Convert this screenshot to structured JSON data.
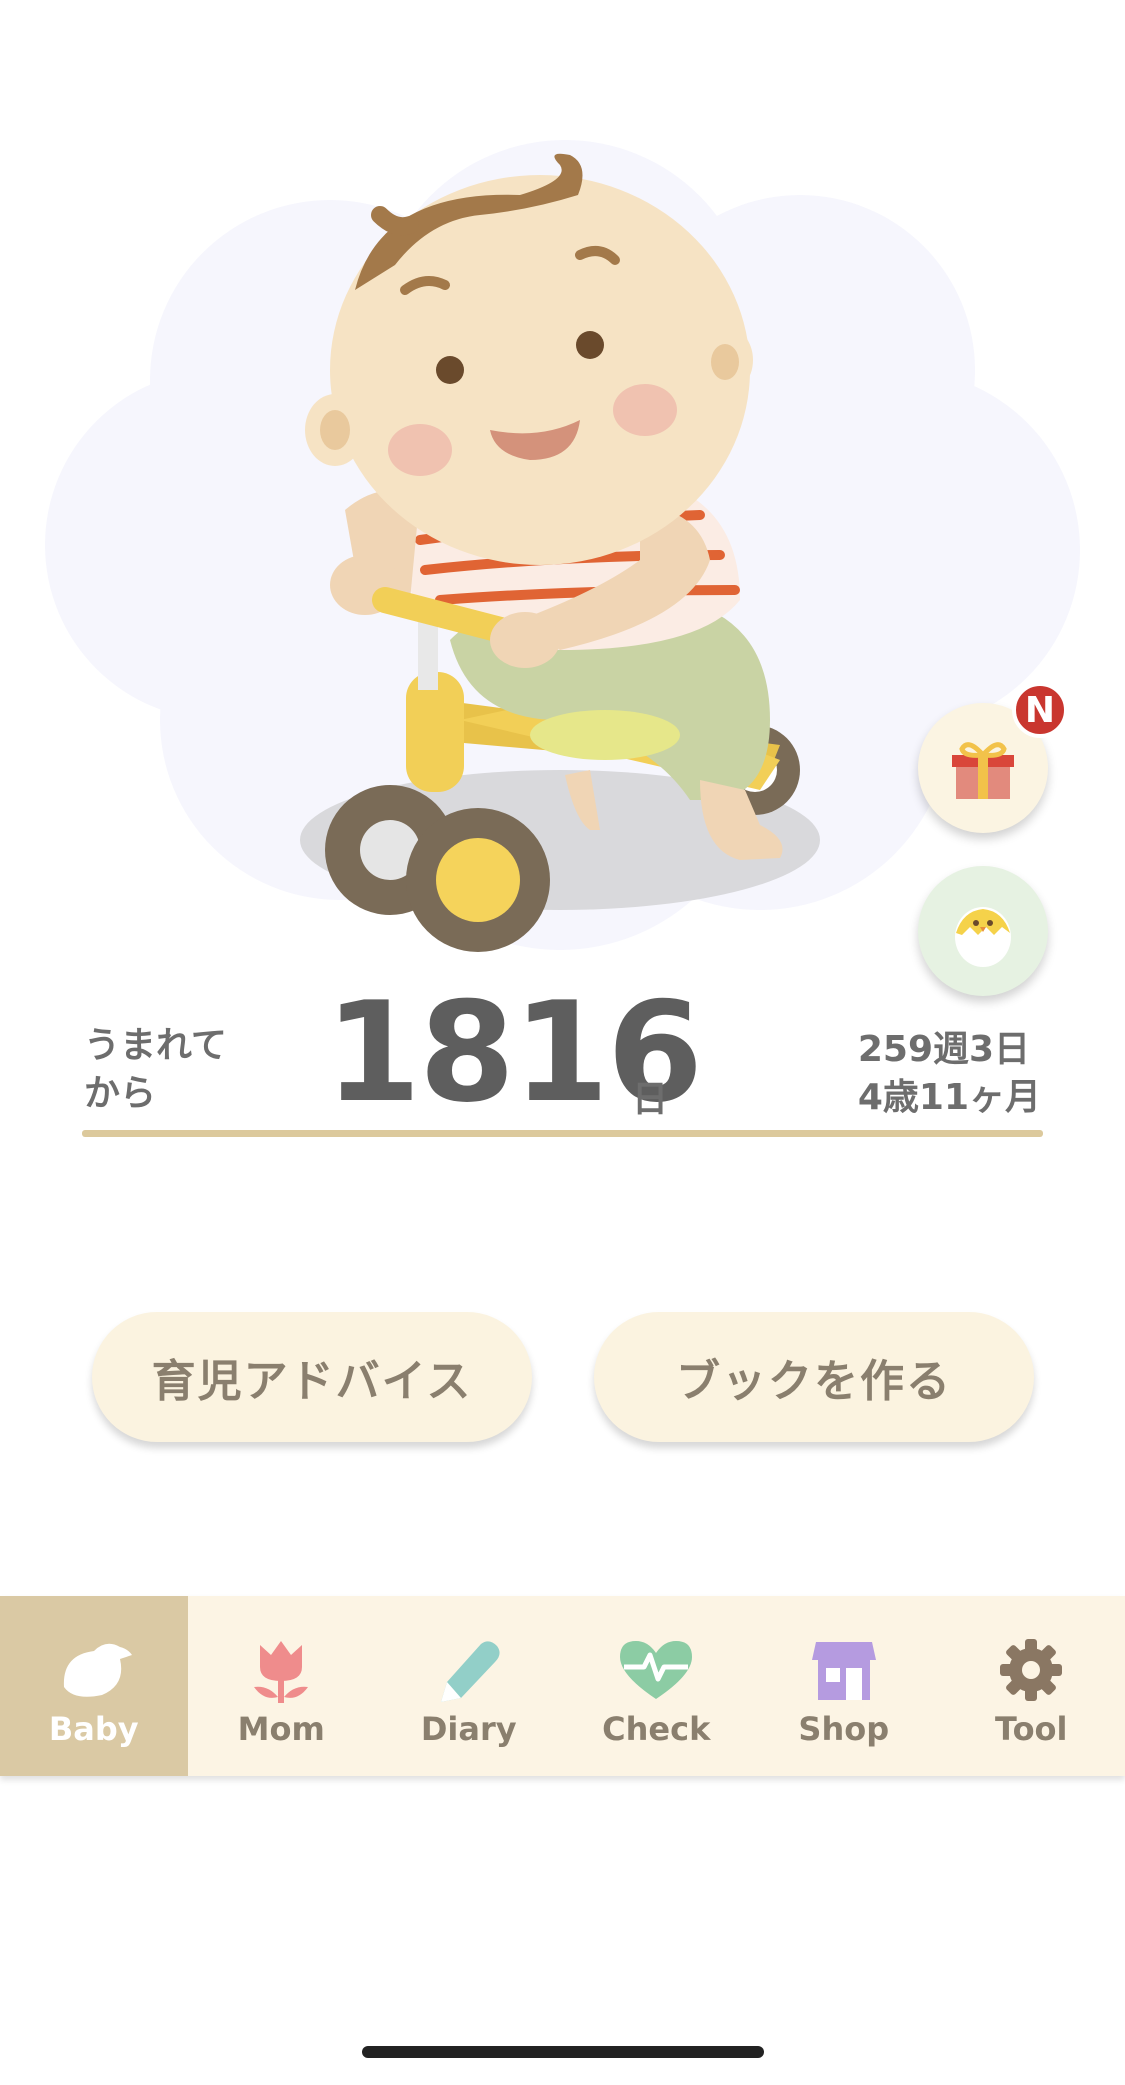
{
  "hero": {
    "since_label": "うまれて\nから",
    "days_count": "1816",
    "days_unit": "日",
    "weeks_text": "259週3日",
    "age_text": "4歳11ヶ月",
    "gift_badge": "N"
  },
  "actions": {
    "advice_label": "育児アドバイス",
    "book_label": "ブックを作る"
  },
  "tabs": [
    {
      "label": "Baby",
      "icon": "bird-icon",
      "color": "#ffffff",
      "active": true
    },
    {
      "label": "Mom",
      "icon": "tulip-icon",
      "color": "#8a7f6e"
    },
    {
      "label": "Diary",
      "icon": "pencil-icon",
      "color": "#8a7f6e"
    },
    {
      "label": "Check",
      "icon": "heart-pulse-icon",
      "color": "#8a7f6e"
    },
    {
      "label": "Shop",
      "icon": "store-icon",
      "color": "#8a7f6e"
    },
    {
      "label": "Tool",
      "icon": "gear-icon",
      "color": "#8a7f6e"
    }
  ],
  "colors": {
    "accent": "#dac9a4",
    "badge": "#c9362f",
    "rule": "#dcc99c"
  }
}
